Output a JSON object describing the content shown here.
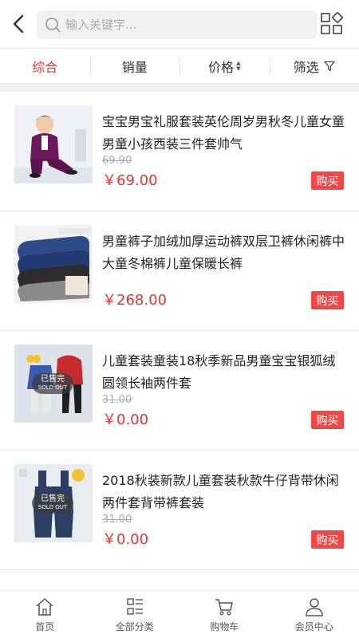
{
  "search": {
    "placeholder": "输入关键字..."
  },
  "sort": {
    "items": [
      {
        "label": "综合"
      },
      {
        "label": "销量"
      },
      {
        "label": "价格"
      },
      {
        "label": "筛选"
      }
    ]
  },
  "products": [
    {
      "title": "宝宝男宝礼服套装英伦周岁男秋冬儿童女童男童小孩西装三件套帅气",
      "old_price": "69.90",
      "price": "￥69.00",
      "buy": "购买"
    },
    {
      "title": "男童裤子加绒加厚运动裤双层卫裤休闲裤中大童冬棉裤儿童保暖长裤",
      "old_price": "",
      "price": "￥268.00",
      "buy": "购买"
    },
    {
      "title": "儿童套装童装18秋季新品男童宝宝银狐绒圆领长袖两件套",
      "old_price": "31.00",
      "price": "￥0.00",
      "buy": "购买",
      "thumb_badge": "已售完",
      "thumb_badge_en": "SOLD OUT"
    },
    {
      "title": "2018秋装新款儿童套装秋款牛仔背带休闲两件套背带裤套装",
      "old_price": "31.00",
      "price": "￥0.00",
      "buy": "购买",
      "thumb_badge": "已售完",
      "thumb_badge_en": "SOLD OUT"
    }
  ],
  "tabbar": {
    "items": [
      {
        "label": "首页",
        "icon": "home-icon"
      },
      {
        "label": "全部分类",
        "icon": "category-icon"
      },
      {
        "label": "购物车",
        "icon": "cart-icon"
      },
      {
        "label": "会员中心",
        "icon": "user-icon"
      }
    ]
  },
  "colors": {
    "accent": "#e8342f",
    "buy_button": "#f04747"
  }
}
